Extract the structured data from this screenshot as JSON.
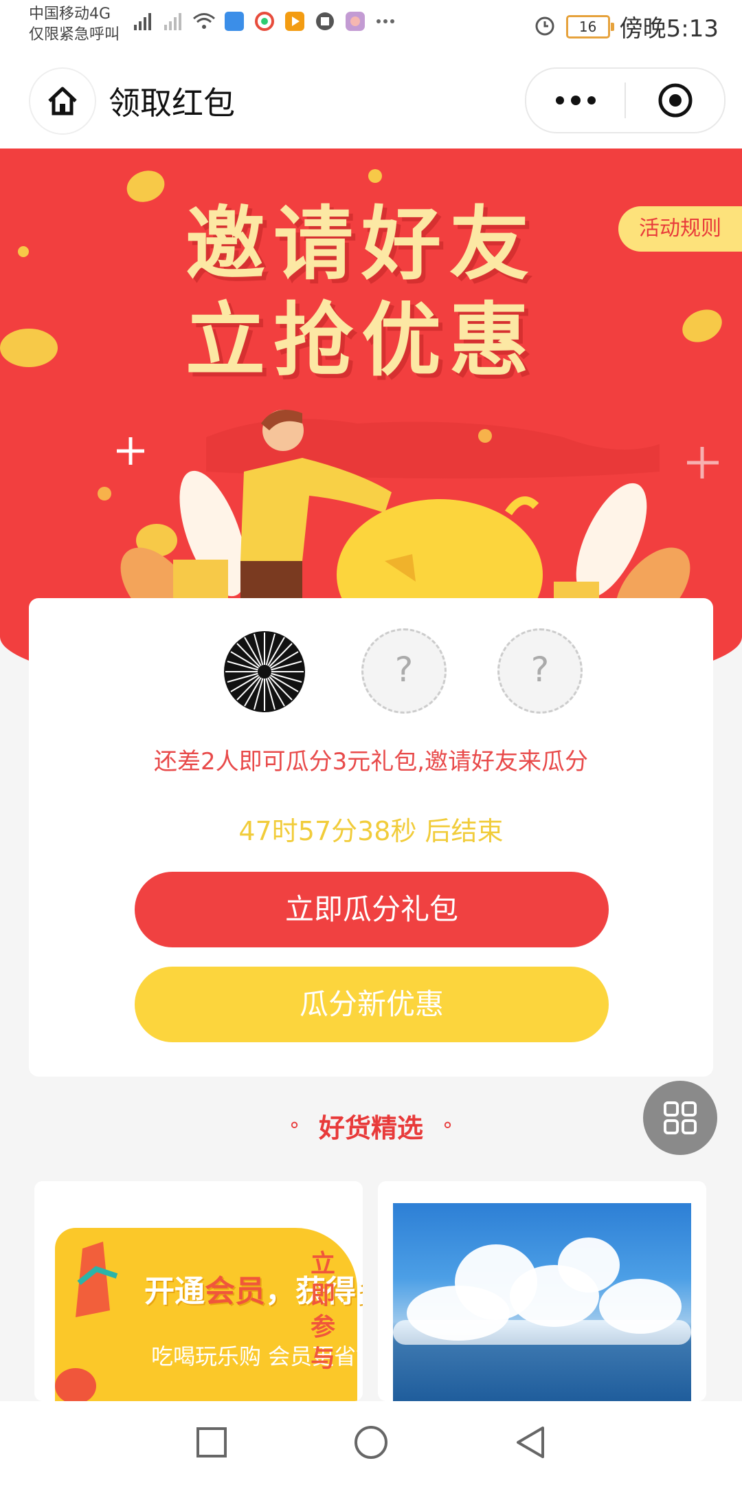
{
  "status_bar": {
    "carrier_line1": "中国移动4G",
    "carrier_line2": "仅限紧急呼叫",
    "battery": "16",
    "time": "傍晚5:13"
  },
  "nav": {
    "title": "领取红包"
  },
  "banner": {
    "rules_label": "活动规则",
    "headline_line1": "邀请好友",
    "headline_line2": "立抢优惠"
  },
  "invite_card": {
    "placeholder_mark": "?",
    "tip": "还差2人即可瓜分3元礼包,邀请好友来瓜分",
    "countdown": "47时57分38秒 后结束",
    "primary_button": "立即瓜分礼包",
    "secondary_button": "瓜分新优惠"
  },
  "section": {
    "title": "好货精选"
  },
  "products": {
    "left": {
      "promo_title_a": "开通",
      "promo_title_em": "会员",
      "promo_title_b": "，获得多种特权",
      "promo_sub": "吃喝玩乐购 会员更省钱",
      "promo_cta": "立即参与"
    }
  },
  "colors": {
    "brand_red": "#f04141",
    "brand_yellow": "#fcd53d"
  }
}
